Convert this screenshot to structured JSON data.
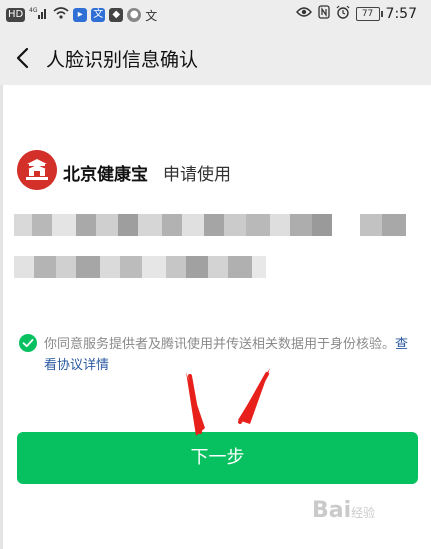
{
  "status_bar": {
    "icons_left": [
      "hd-icon",
      "signal-icon",
      "wifi-icon",
      "notification-icon",
      "translate-icon",
      "app-icon",
      "chat-icon",
      "input-icon"
    ],
    "hd_label": "HD",
    "time": "7:57",
    "battery": "77"
  },
  "header": {
    "title": "人脸识别信息确认"
  },
  "app": {
    "name": "北京健康宝",
    "action": "申请使用",
    "logo_color": "#d4302a"
  },
  "consent": {
    "text": "你同意服务提供者及腾讯使用并传送相关数据用于身份核验。",
    "link_part1": "查看",
    "link_part2": "协议详情"
  },
  "primary_button": {
    "label": "下一步",
    "color": "#07c160"
  },
  "watermark": {
    "text": "Bai",
    "suffix": "经验"
  },
  "colors": {
    "accent_green": "#07c160",
    "link_blue": "#2b5aa0",
    "annotation_red": "#e8201b"
  }
}
